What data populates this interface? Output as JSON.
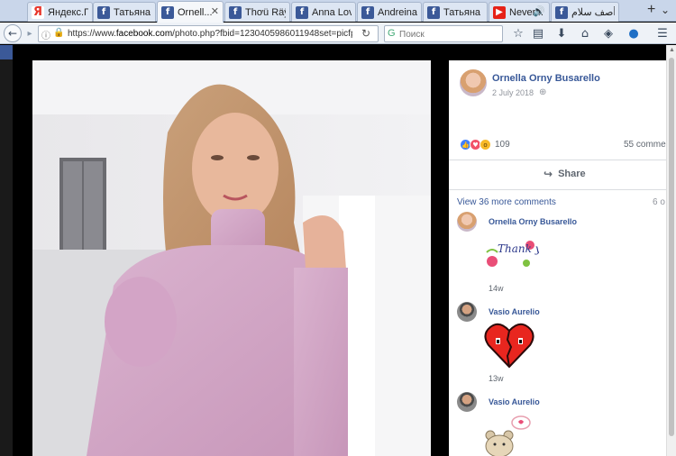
{
  "tabs": [
    {
      "label": "Яндекс.П...",
      "icon": "yandex-icon",
      "active": false
    },
    {
      "label": "Татьяна ...",
      "icon": "facebook-icon",
      "active": false
    },
    {
      "label": "Ornell...",
      "icon": "facebook-icon",
      "active": true
    },
    {
      "label": "Thơü Räÿæ",
      "icon": "facebook-icon",
      "active": false
    },
    {
      "label": "Anna Love",
      "icon": "facebook-icon",
      "active": false
    },
    {
      "label": "Andreina ...",
      "icon": "facebook-icon",
      "active": false
    },
    {
      "label": "Татьяна ...",
      "icon": "facebook-icon",
      "active": false
    },
    {
      "label": "Never...",
      "icon": "youtube-icon",
      "active": false
    },
    {
      "label": "أصف سلام",
      "icon": "facebook-icon",
      "active": false
    }
  ],
  "nav": {
    "url_prefix": "https://www.",
    "url_domain": "facebook.com",
    "url_rest": "/photo.php?fbid=1230405986011948set=picfp.100026",
    "search_placeholder": "Поиск"
  },
  "post": {
    "author": "Ornella Orny Busarello",
    "date": "2 July 2018",
    "reaction_count": "109",
    "comments_count": "55 comme",
    "share_label": "Share",
    "view_more": "View 36 more comments",
    "more_count": "6 o"
  },
  "comments": [
    {
      "name": "Ornella Orny Busarello",
      "sticker": "thank-you-sticker",
      "sticker_text": "Thank you",
      "time": "14w"
    },
    {
      "name": "Vasio Aurelio",
      "sticker": "heart-sticker",
      "time": "13w"
    },
    {
      "name": "Vasio Aurelio",
      "sticker": "teddy-bear-sticker"
    }
  ],
  "colors": {
    "facebook_blue": "#3b5998",
    "link_blue": "#385898",
    "sweater_pink": "#d6a8c8"
  }
}
